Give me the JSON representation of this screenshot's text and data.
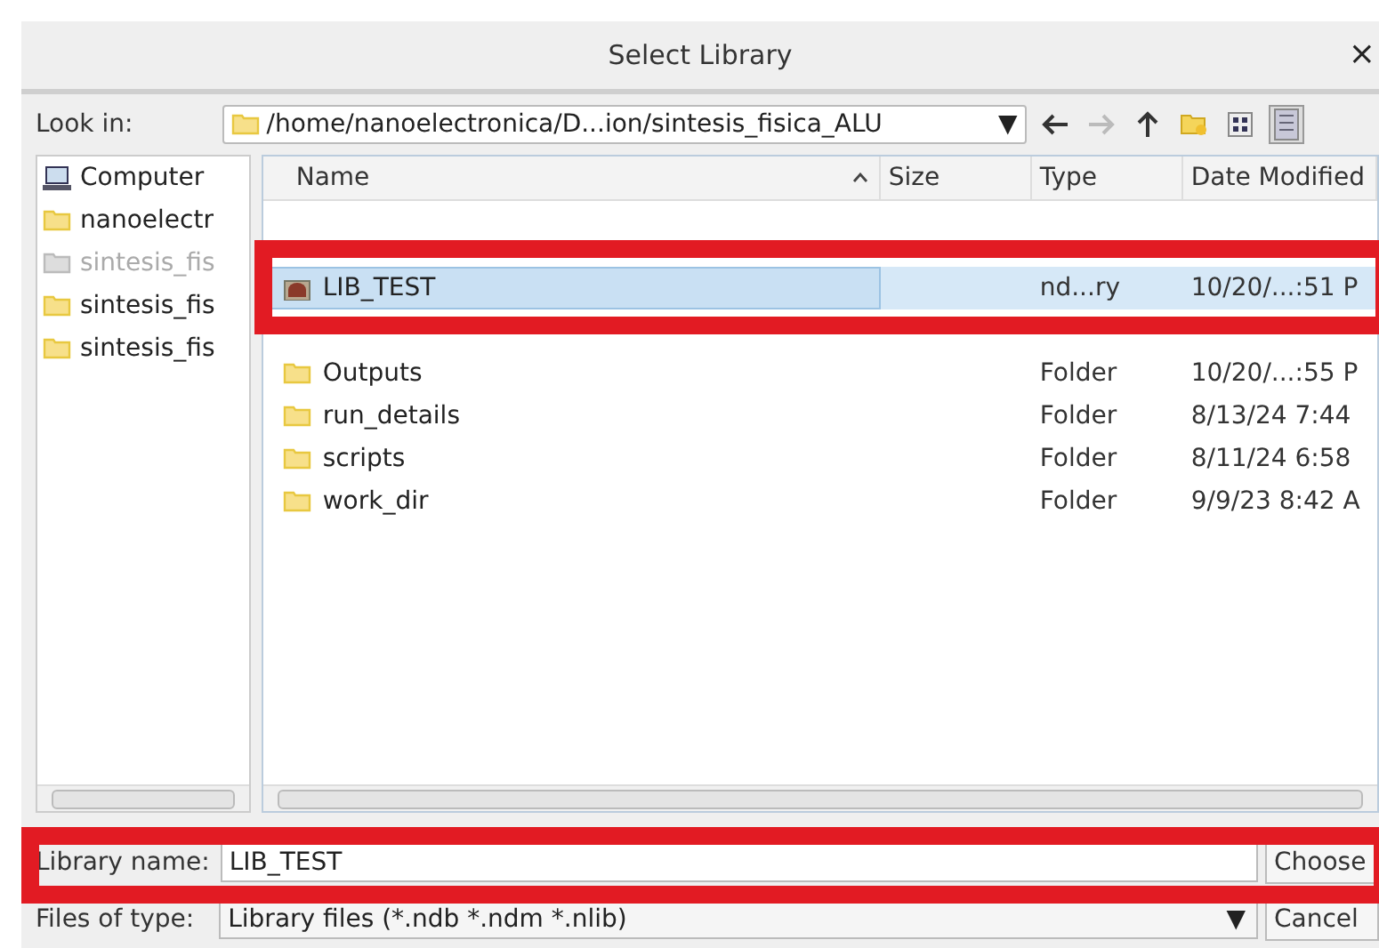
{
  "window": {
    "title": "Select Library",
    "close": "×"
  },
  "look_in": {
    "label": "Look in:",
    "path": "/home/nanoelectronica/D...ion/sintesis_fisica_ALU",
    "arrow": "▼"
  },
  "toolbar": [
    {
      "kind": "back"
    },
    {
      "kind": "forward",
      "disabled": true
    },
    {
      "kind": "up"
    },
    {
      "kind": "new_folder"
    },
    {
      "kind": "list_view",
      "selected": false
    },
    {
      "kind": "detail_view",
      "selected": true
    }
  ],
  "sidebar": {
    "items": [
      {
        "kind": "computer",
        "label": "Computer",
        "disabled": false
      },
      {
        "kind": "folder",
        "label": "nanoelectr",
        "disabled": false
      },
      {
        "kind": "folder",
        "label": "sintesis_fis",
        "disabled": true
      },
      {
        "kind": "folder",
        "label": "sintesis_fis",
        "disabled": false
      },
      {
        "kind": "folder",
        "label": "sintesis_fis",
        "disabled": false
      }
    ]
  },
  "table": {
    "columns": [
      {
        "label": "Name",
        "sorted": true
      },
      {
        "label": "Size",
        "sorted": false
      },
      {
        "label": "Type",
        "sorted": false
      },
      {
        "label": "Date Modified",
        "sorted": false
      }
    ],
    "rows": [
      {
        "kind": "library",
        "name": "LIB_TEST",
        "type": "nd...ry",
        "date": "10/20/...:51 P",
        "selected": true
      },
      {
        "kind": "folder",
        "name": "Outputs",
        "type": "Folder",
        "date": "10/20/...:55 P",
        "selected": false
      },
      {
        "kind": "folder",
        "name": "run_details",
        "type": "Folder",
        "date": "8/13/24 7:44",
        "selected": false
      },
      {
        "kind": "folder",
        "name": "scripts",
        "type": "Folder",
        "date": "8/11/24 6:58",
        "selected": false
      },
      {
        "kind": "folder",
        "name": "work_dir",
        "type": "Folder",
        "date": "9/9/23 8:42 A",
        "selected": false
      }
    ]
  },
  "library_name": {
    "label": "Library name:",
    "value": "LIB_TEST",
    "button": "Choose"
  },
  "files_of_type": {
    "label": "Files of type:",
    "value": "Library files (*.ndb *.ndm *.nlib)",
    "arrow": "▼",
    "button": "Cancel"
  }
}
